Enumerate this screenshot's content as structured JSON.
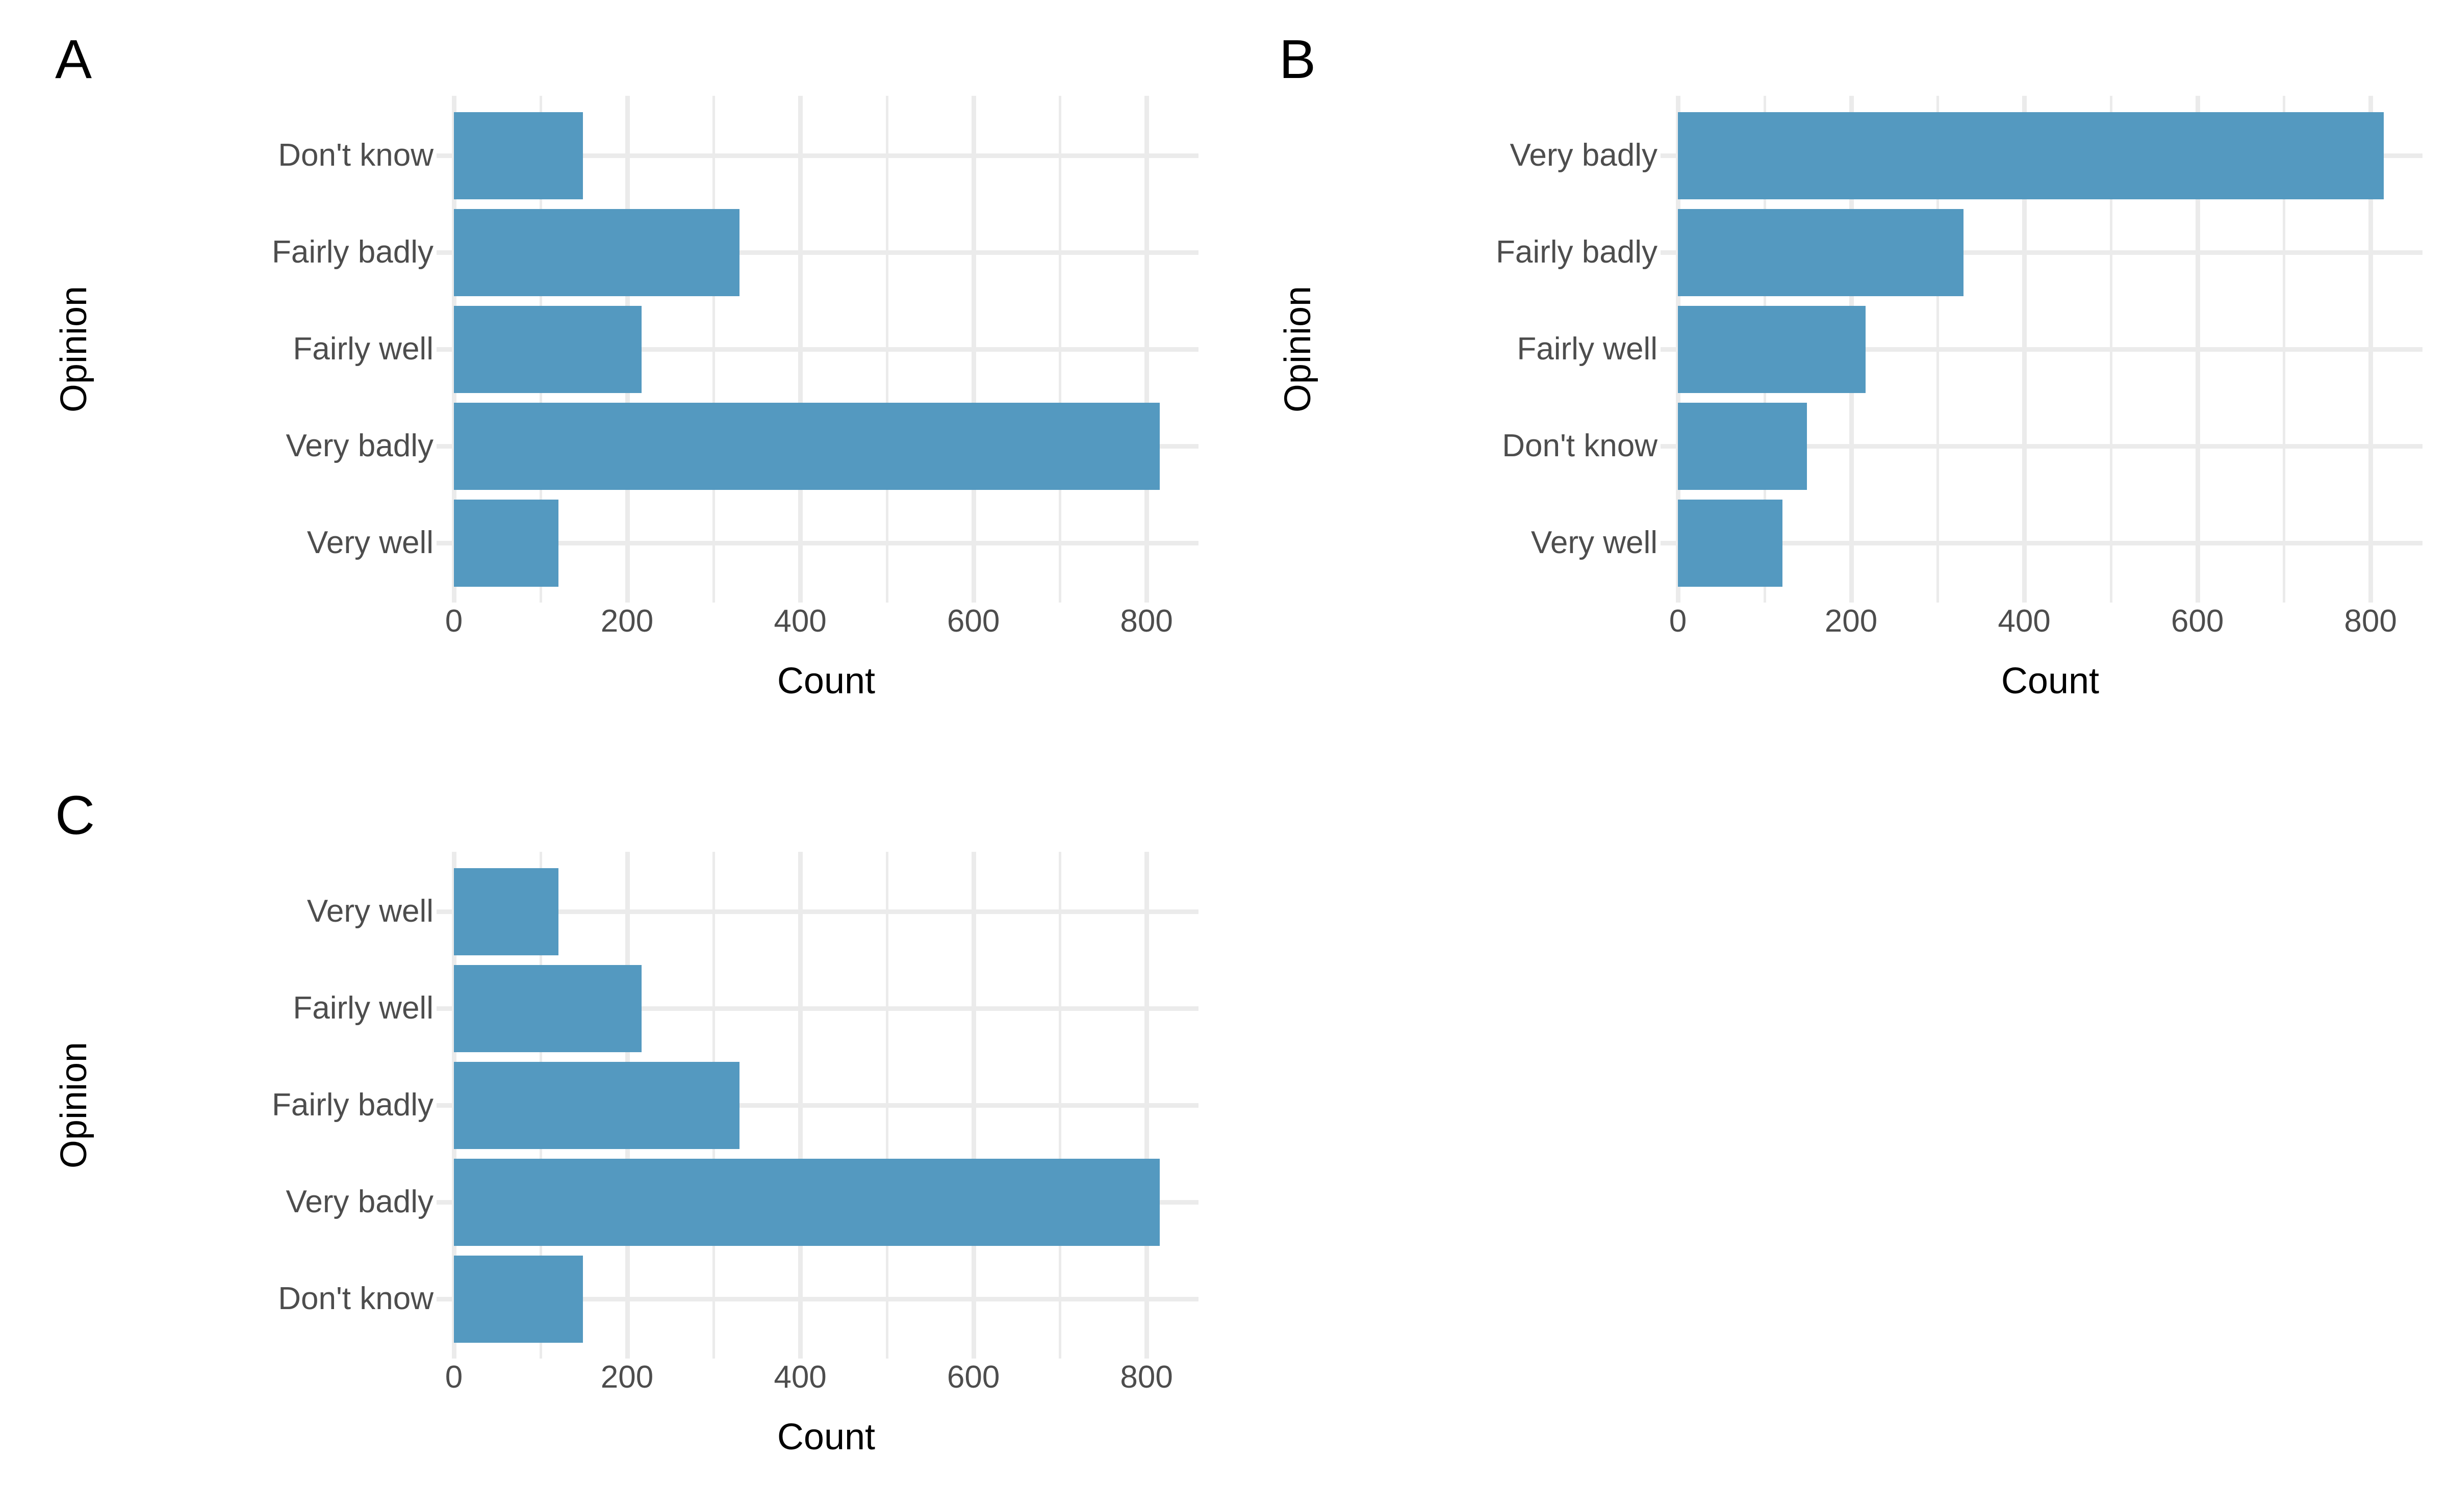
{
  "figure": {
    "background": "#ffffff",
    "bar_color": "#5499c0",
    "grid_color": "#ebebeb",
    "tick_label_color": "#4d4d4d",
    "axis_title_color": "#000000",
    "panels": [
      "A",
      "B",
      "C"
    ]
  },
  "panels": {
    "A": {
      "tag": "A"
    },
    "B": {
      "tag": "B"
    },
    "C": {
      "tag": "C"
    }
  },
  "chart_data": [
    {
      "type": "bar",
      "orientation": "horizontal",
      "panel": "A",
      "title": "A",
      "xlabel": "Count",
      "ylabel": "Opinion",
      "categories": [
        "Don't know",
        "Fairly badly",
        "Fairly well",
        "Very badly",
        "Very well"
      ],
      "values": [
        149,
        330,
        217,
        815,
        121
      ],
      "category_order": "alphabetical",
      "xlim": [
        0,
        860
      ],
      "xticks": [
        0,
        200,
        400,
        600,
        800
      ],
      "xticklabels": [
        "0",
        "200",
        "400",
        "600",
        "800"
      ],
      "xminor_ticks": [
        100,
        300,
        500,
        700
      ],
      "grid": "major-and-minor vertical, major horizontal",
      "legend": "none"
    },
    {
      "type": "bar",
      "orientation": "horizontal",
      "panel": "B",
      "title": "B",
      "xlabel": "Count",
      "ylabel": "Opinion",
      "categories": [
        "Very badly",
        "Fairly badly",
        "Fairly well",
        "Don't know",
        "Very well"
      ],
      "values": [
        815,
        330,
        217,
        149,
        121
      ],
      "category_order": "descending-by-count",
      "xlim": [
        0,
        860
      ],
      "xticks": [
        0,
        200,
        400,
        600,
        800
      ],
      "xticklabels": [
        "0",
        "200",
        "400",
        "600",
        "800"
      ],
      "xminor_ticks": [
        100,
        300,
        500,
        700
      ],
      "grid": "major-and-minor vertical, major horizontal",
      "legend": "none"
    },
    {
      "type": "bar",
      "orientation": "horizontal",
      "panel": "C",
      "title": "C",
      "xlabel": "Count",
      "ylabel": "Opinion",
      "categories": [
        "Very well",
        "Fairly well",
        "Fairly badly",
        "Very badly",
        "Don't know"
      ],
      "values": [
        121,
        217,
        330,
        815,
        149
      ],
      "category_order": "likert-scale",
      "xlim": [
        0,
        860
      ],
      "xticks": [
        0,
        200,
        400,
        600,
        800
      ],
      "xticklabels": [
        "0",
        "200",
        "400",
        "600",
        "800"
      ],
      "xminor_ticks": [
        100,
        300,
        500,
        700
      ],
      "grid": "major-and-minor vertical, major horizontal",
      "legend": "none"
    }
  ]
}
